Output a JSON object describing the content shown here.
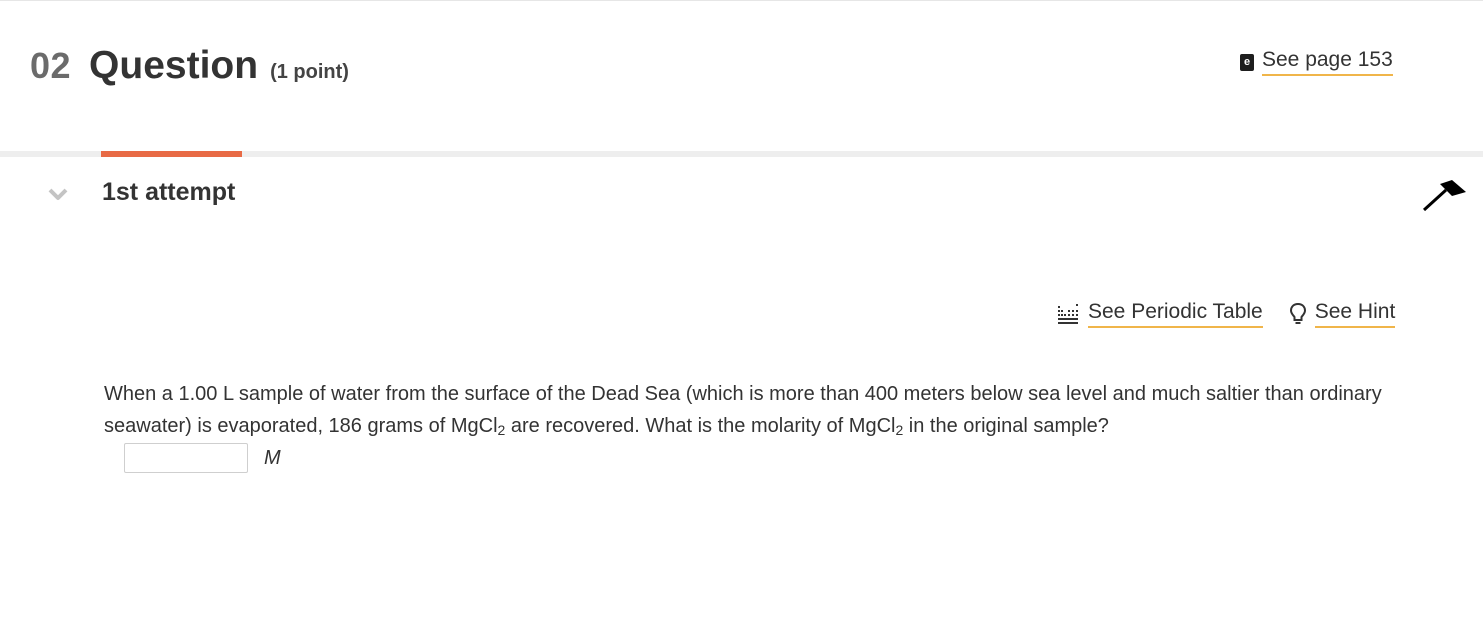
{
  "question": {
    "number": "02",
    "title": "Question",
    "points": "(1 point)"
  },
  "ebook": {
    "icon": "ebook-icon",
    "icon_letter": "e",
    "label": "See page 153"
  },
  "attempt": {
    "label": "1st attempt"
  },
  "tools": {
    "periodic_table_label": "See Periodic Table",
    "hint_label": "See Hint"
  },
  "problem": {
    "text_part1": "When a 1.00 L sample of water from the surface of the Dead Sea (which is more than 400 meters below sea level and much saltier than ordinary seawater) is evaporated, 186 grams of MgCl",
    "sub1": "2",
    "text_part2": " are recovered. What is the molarity of MgCl",
    "sub2": "2",
    "text_part3": " in the original sample?"
  },
  "answer": {
    "value": "",
    "unit": "M"
  },
  "colors": {
    "accent_bar": "#e86a45",
    "link_underline": "#f0b54a"
  }
}
